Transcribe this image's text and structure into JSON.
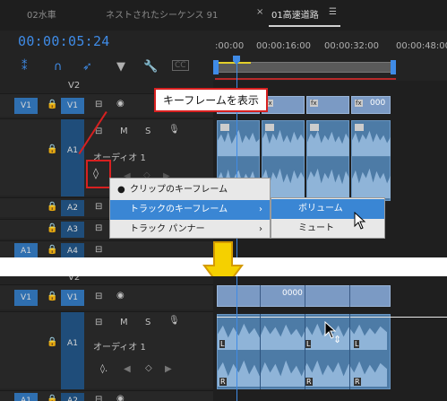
{
  "tabs": [
    {
      "label": "02水車"
    },
    {
      "label": "ネストされたシーケンス 91"
    },
    {
      "label": "01高速道路",
      "active": true
    }
  ],
  "tab_close": "×",
  "tab_menu": "☰",
  "timecode": "00:00:05:24",
  "ruler": [
    ":00:00",
    "00:00:16:00",
    "00:00:32:00",
    "00:00:48:00"
  ],
  "tracks_top": [
    {
      "src": "",
      "name": "V2"
    },
    {
      "src": "V1",
      "name": "V1"
    },
    {
      "src": "",
      "name": "A1",
      "label": "オーディオ 1"
    },
    {
      "src": "",
      "name": "A2"
    },
    {
      "src": "",
      "name": "A3"
    },
    {
      "src": "A1",
      "name": "A4"
    }
  ],
  "track_letters": {
    "m": "M",
    "s": "S"
  },
  "clip_codes": [
    "fx",
    "fx",
    "fx",
    "fx",
    "000"
  ],
  "clip_channel": {
    "left": "L",
    "right": "R"
  },
  "callout": "キーフレームを表示",
  "menu": {
    "items": [
      {
        "label": "クリップのキーフレーム",
        "checked": true
      },
      {
        "label": "トラックのキーフレーム",
        "submenu": true,
        "highlighted": true
      },
      {
        "label": "トラック パンナー",
        "submenu": true
      }
    ],
    "submenu": [
      {
        "label": "ボリューム",
        "highlighted": true
      },
      {
        "label": "ミュート"
      }
    ]
  },
  "tracks_bottom": [
    {
      "src": "",
      "name": "V2"
    },
    {
      "src": "V1",
      "name": "V1"
    },
    {
      "src": "",
      "name": "A1",
      "label": "オーディオ 1"
    },
    {
      "src": "A1",
      "name": "A2"
    }
  ],
  "clip_code_bottom": "0000",
  "arrow_color": "#f5d000",
  "accent": "#3f8be6",
  "highlight": "#d82020"
}
